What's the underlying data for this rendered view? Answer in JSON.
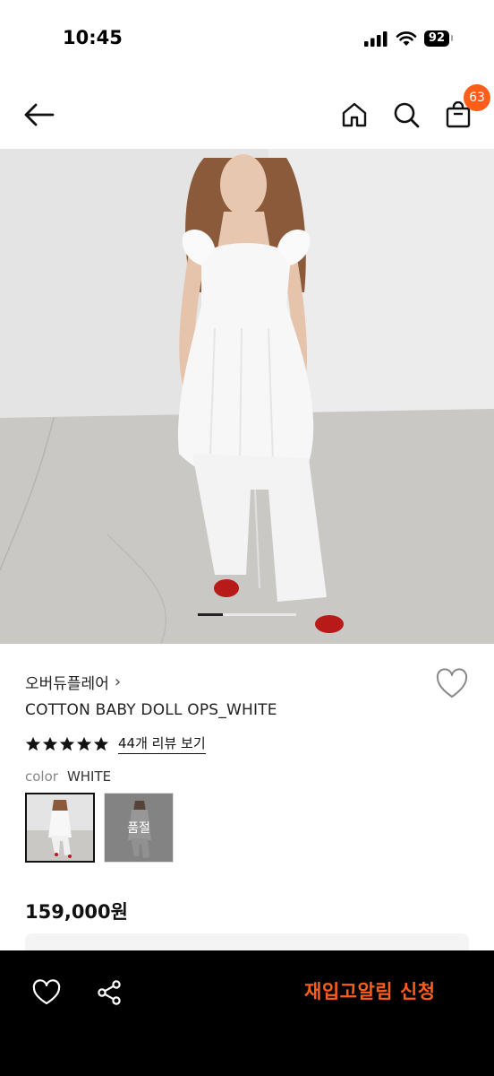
{
  "status_bar": {
    "time": "10:45",
    "battery": "92"
  },
  "header": {
    "back_icon": "arrow-left-icon",
    "home_icon": "home-icon",
    "search_icon": "search-icon",
    "cart_icon": "shopping-bag-icon",
    "cart_count": "63"
  },
  "gallery": {
    "current_index": 0,
    "total": 4
  },
  "product": {
    "brand": "오버듀플레어",
    "brand_chevron": "›",
    "name": "COTTON BABY DOLL OPS_WHITE",
    "rating": 5,
    "review_link": "44개 리뷰 보기",
    "color_label": "color",
    "color_value": "WHITE",
    "swatches": [
      {
        "selected": true,
        "sold_out": false
      },
      {
        "selected": false,
        "sold_out": true,
        "sold_out_label": "품절"
      }
    ],
    "price": "159,000원"
  },
  "bottom_bar": {
    "wishlist_icon": "heart-icon",
    "share_icon": "share-icon",
    "restock_label": "재입고알림 신청"
  },
  "colors": {
    "accent": "#ff5e1a",
    "bottom_bar": "#000000"
  }
}
